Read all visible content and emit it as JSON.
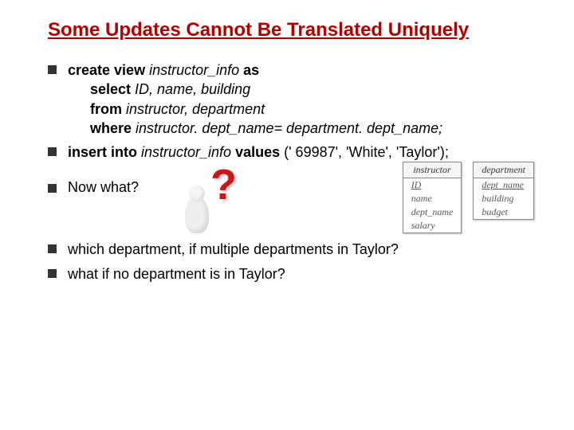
{
  "title": "Some Updates Cannot Be Translated Uniquely",
  "b1": {
    "l1a": "create view ",
    "l1b": "instructor_info ",
    "l1c": "as",
    "l2a": "select ",
    "l2b": "ID, name, building",
    "l3a": "from ",
    "l3b": "instructor, department",
    "l4a": "where ",
    "l4b": "instructor. dept_name= department. dept_name;"
  },
  "b2": {
    "a": "insert into ",
    "b": "instructor_info ",
    "c": "values ",
    "d": "(' 69987', 'White', 'Taylor');"
  },
  "b3": "Now what?",
  "b4": "which department, if multiple departments in Taylor?",
  "b5": "what if no department is in Taylor?",
  "schema": {
    "instructor": {
      "title": "instructor",
      "cols": [
        "ID",
        "name",
        "dept_name",
        "salary"
      ]
    },
    "department": {
      "title": "department",
      "cols": [
        "dept_name",
        "building",
        "budget"
      ]
    }
  }
}
